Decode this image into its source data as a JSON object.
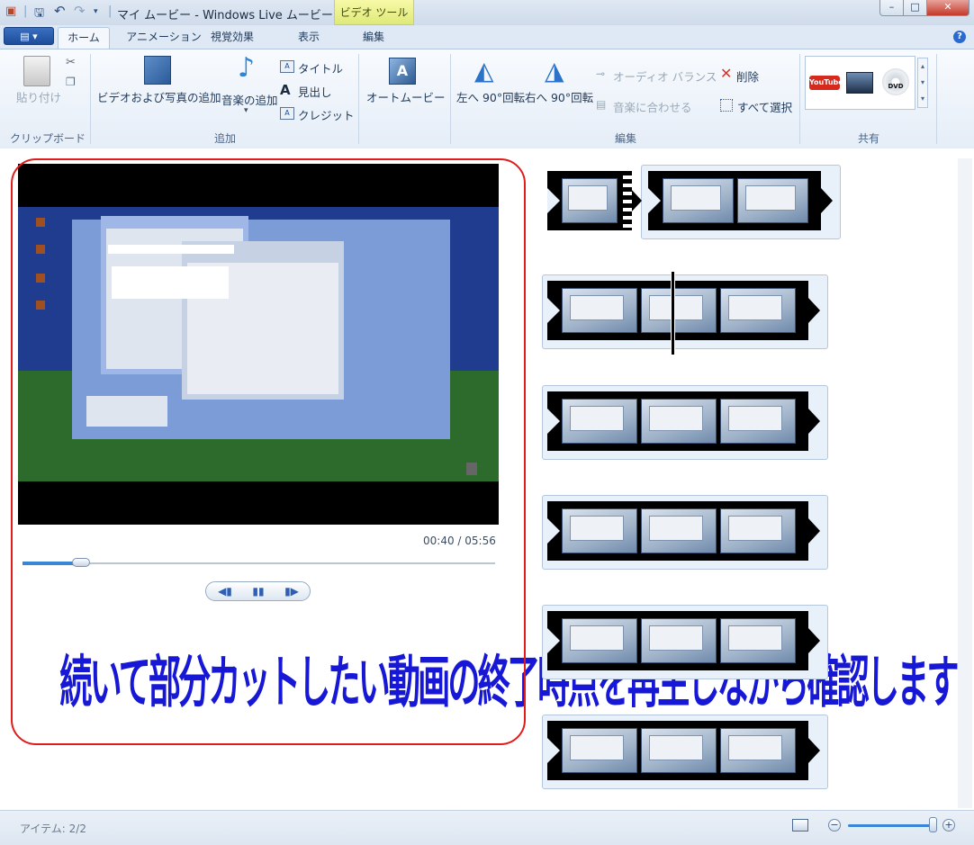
{
  "window": {
    "title": "マイ ムービー - Windows Live ムービー ...",
    "context_tab": "ビデオ ツール",
    "controls": {
      "minimize": "–",
      "maximize": "□",
      "close": "✕"
    }
  },
  "quick_access": {
    "icons": [
      "film-icon",
      "save-icon",
      "undo-icon",
      "redo-icon",
      "customize-icon"
    ]
  },
  "tabs": [
    {
      "label": "ホーム",
      "active": true
    },
    {
      "label": "アニメーション",
      "active": false
    },
    {
      "label": "視覚効果",
      "active": false
    },
    {
      "label": "表示",
      "active": false
    },
    {
      "label": "編集",
      "active": false
    }
  ],
  "app_menu": {
    "label": "▤ ▾"
  },
  "help": {
    "label": "?"
  },
  "ribbon": {
    "clipboard": {
      "group": "クリップボード",
      "paste": "貼り付け"
    },
    "add": {
      "group": "追加",
      "add_video_photo": "ビデオおよび写真の追加",
      "add_music": "音楽の追加",
      "title": "タイトル",
      "caption": "見出し",
      "credits": "クレジット"
    },
    "automovie": {
      "label": "オートムービー"
    },
    "edit": {
      "group": "編集",
      "rotate_left": "左へ 90°回転",
      "rotate_right": "右へ 90°回転",
      "audio_balance": "オーディオ バランス",
      "fit_music": "音楽に合わせる",
      "delete": "削除",
      "select_all": "すべて選択"
    },
    "share": {
      "group": "共有",
      "youtube": "YouTube",
      "dvd": "DVD"
    }
  },
  "preview": {
    "time": "00:40 / 05:56",
    "progress": 0.12,
    "caption": "続いて部分カットしたい動画の終了時点を再生しながら確認します"
  },
  "transport": {
    "prev": "◀▮",
    "pause": "▮▮",
    "next": "▮▶"
  },
  "status": {
    "items": "アイテム: 2/2",
    "zoom_level": 1.0
  },
  "colors": {
    "annotation_outline": "#e21b1b",
    "caption_text": "#1717d6",
    "accent": "#3a86d6"
  }
}
